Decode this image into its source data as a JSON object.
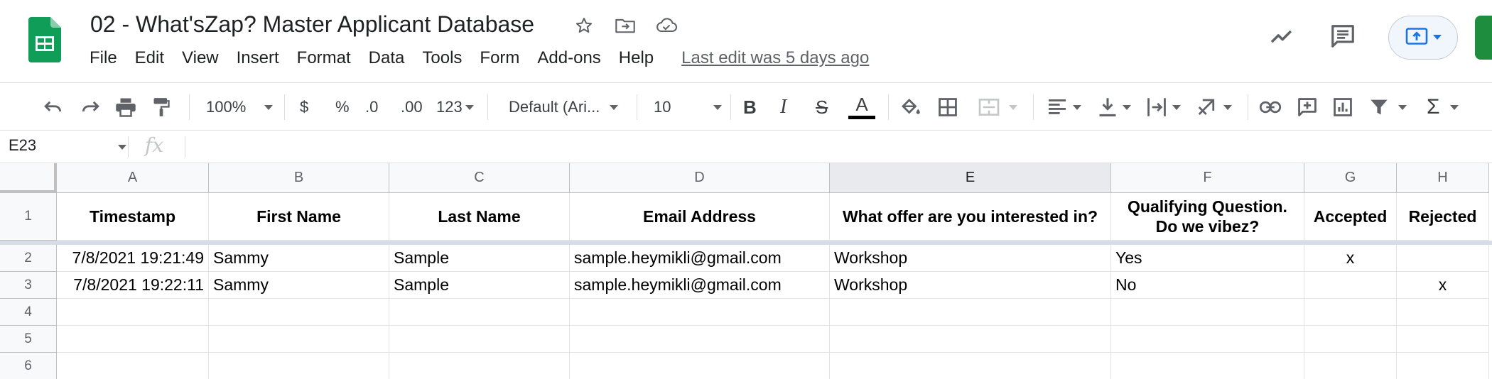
{
  "doc": {
    "title": "02 - What'sZap? Master Applicant Database",
    "last_edit": "Last edit was 5 days ago"
  },
  "title_icons": [
    "star-icon",
    "move-to-folder-icon",
    "cloud-saved-icon"
  ],
  "menu": [
    "File",
    "Edit",
    "View",
    "Insert",
    "Format",
    "Data",
    "Tools",
    "Form",
    "Add-ons",
    "Help"
  ],
  "top_right_icons": [
    "activity-trend-icon",
    "comments-icon",
    "present-upload-icon"
  ],
  "toolbar": {
    "zoom": "100%",
    "currency": "$",
    "percent": "%",
    "decrease_decimal": ".0",
    "increase_decimal": ".00",
    "more_formats": "123",
    "font": "Default (Ari...",
    "font_size": "10",
    "bold": "B",
    "italic": "I",
    "strikethrough": "S",
    "text_color": "A",
    "sigma": "Σ"
  },
  "formula_bar": {
    "cell_ref": "E23",
    "fx": "fx",
    "value": ""
  },
  "columns": [
    "A",
    "B",
    "C",
    "D",
    "E",
    "F",
    "G",
    "H"
  ],
  "selected_column": "E",
  "rows": [
    "1",
    "2",
    "3",
    "4",
    "5",
    "6"
  ],
  "table": {
    "headers": [
      "Timestamp",
      "First Name",
      "Last Name",
      "Email Address",
      "What offer are you interested in?",
      "Qualifying Question. Do we vibez?",
      "Accepted",
      "Rejected"
    ],
    "records": [
      [
        "7/8/2021 19:21:49",
        "Sammy",
        "Sample",
        "sample.heymikli@gmail.com",
        "Workshop",
        "Yes",
        "x",
        ""
      ],
      [
        "7/8/2021 19:22:11",
        "Sammy",
        "Sample",
        "sample.heymikli@gmail.com",
        "Workshop",
        "No",
        "",
        "x"
      ]
    ]
  },
  "colors": {
    "sheets_green": "#0f9d58",
    "share_blue": "#1a73e8",
    "gridline": "#e2e3e3",
    "header_bg": "#f8f9fa"
  }
}
